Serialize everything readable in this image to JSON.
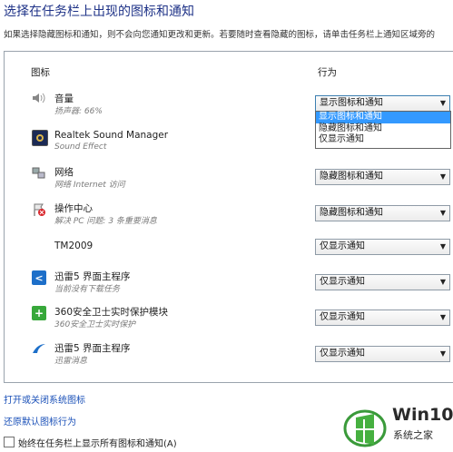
{
  "title": "选择在任务栏上出现的图标和通知",
  "description": "如果选择隐藏图标和通知，则不会向您通知更改和更新。若要随时查看隐藏的图标，请单击任务栏上通知区域旁的",
  "columns": {
    "icon": "图标",
    "behavior": "行为"
  },
  "rows": [
    {
      "name": "音量",
      "sub": "扬声器: 66%",
      "icon": "speaker-icon",
      "behavior": "显示图标和通知"
    },
    {
      "name": "Realtek Sound Manager",
      "sub": "Sound Effect",
      "icon": "realtek-icon",
      "behavior": ""
    },
    {
      "name": "网络",
      "sub": "网络 Internet 访问",
      "icon": "network-icon",
      "behavior": "隐藏图标和通知"
    },
    {
      "name": "操作中心",
      "sub": "解决 PC 问题: 3 条重要消息",
      "icon": "action-center-flag-icon",
      "behavior": "隐藏图标和通知"
    },
    {
      "name": "TM2009",
      "sub": "",
      "icon": "",
      "behavior": "仅显示通知"
    },
    {
      "name": "迅雷5 界面主程序",
      "sub": "当前没有下载任务",
      "icon": "xunlei-icon",
      "behavior": "仅显示通知"
    },
    {
      "name": "360安全卫士实时保护模块",
      "sub": "360安全卫士实时保护",
      "icon": "360-shield-icon",
      "behavior": "仅显示通知"
    },
    {
      "name": "迅雷5 界面主程序",
      "sub": "迅雷消息",
      "icon": "xunlei-bird-icon",
      "behavior": "仅显示通知"
    }
  ],
  "dropdown_options": [
    "显示图标和通知",
    "隐藏图标和通知",
    "仅显示通知"
  ],
  "links": {
    "system_icons": "打开或关闭系统图标",
    "restore_default": "还原默认图标行为"
  },
  "always_show_label": "始终在任务栏上显示所有图标和通知(A)",
  "watermark": {
    "brand": "Win10",
    "sub": "系统之家"
  },
  "colors": {
    "title": "#1e3287",
    "link": "#1a50b8",
    "highlight": "#3399ff"
  }
}
